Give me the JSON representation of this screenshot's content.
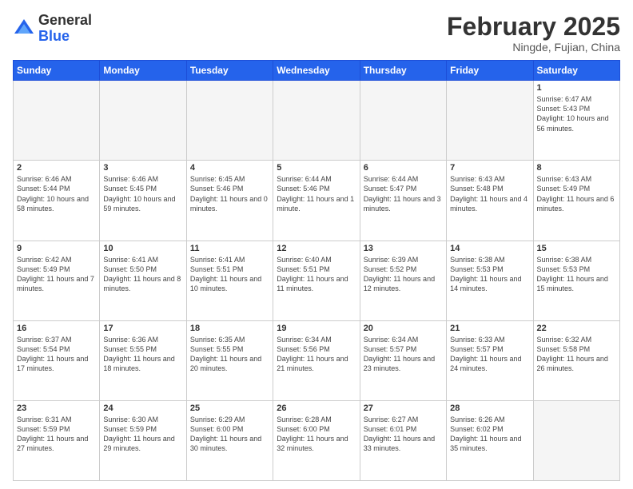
{
  "logo": {
    "general": "General",
    "blue": "Blue"
  },
  "title": {
    "month_year": "February 2025",
    "location": "Ningde, Fujian, China"
  },
  "weekdays": [
    "Sunday",
    "Monday",
    "Tuesday",
    "Wednesday",
    "Thursday",
    "Friday",
    "Saturday"
  ],
  "weeks": [
    [
      {
        "day": "",
        "empty": true
      },
      {
        "day": "",
        "empty": true
      },
      {
        "day": "",
        "empty": true
      },
      {
        "day": "",
        "empty": true
      },
      {
        "day": "",
        "empty": true
      },
      {
        "day": "",
        "empty": true
      },
      {
        "day": "1",
        "sunrise": "6:47 AM",
        "sunset": "5:43 PM",
        "daylight": "10 hours and 56 minutes."
      }
    ],
    [
      {
        "day": "2",
        "sunrise": "6:46 AM",
        "sunset": "5:44 PM",
        "daylight": "10 hours and 58 minutes."
      },
      {
        "day": "3",
        "sunrise": "6:46 AM",
        "sunset": "5:45 PM",
        "daylight": "10 hours and 59 minutes."
      },
      {
        "day": "4",
        "sunrise": "6:45 AM",
        "sunset": "5:46 PM",
        "daylight": "11 hours and 0 minutes."
      },
      {
        "day": "5",
        "sunrise": "6:44 AM",
        "sunset": "5:46 PM",
        "daylight": "11 hours and 1 minute."
      },
      {
        "day": "6",
        "sunrise": "6:44 AM",
        "sunset": "5:47 PM",
        "daylight": "11 hours and 3 minutes."
      },
      {
        "day": "7",
        "sunrise": "6:43 AM",
        "sunset": "5:48 PM",
        "daylight": "11 hours and 4 minutes."
      },
      {
        "day": "8",
        "sunrise": "6:43 AM",
        "sunset": "5:49 PM",
        "daylight": "11 hours and 6 minutes."
      }
    ],
    [
      {
        "day": "9",
        "sunrise": "6:42 AM",
        "sunset": "5:49 PM",
        "daylight": "11 hours and 7 minutes."
      },
      {
        "day": "10",
        "sunrise": "6:41 AM",
        "sunset": "5:50 PM",
        "daylight": "11 hours and 8 minutes."
      },
      {
        "day": "11",
        "sunrise": "6:41 AM",
        "sunset": "5:51 PM",
        "daylight": "11 hours and 10 minutes."
      },
      {
        "day": "12",
        "sunrise": "6:40 AM",
        "sunset": "5:51 PM",
        "daylight": "11 hours and 11 minutes."
      },
      {
        "day": "13",
        "sunrise": "6:39 AM",
        "sunset": "5:52 PM",
        "daylight": "11 hours and 12 minutes."
      },
      {
        "day": "14",
        "sunrise": "6:38 AM",
        "sunset": "5:53 PM",
        "daylight": "11 hours and 14 minutes."
      },
      {
        "day": "15",
        "sunrise": "6:38 AM",
        "sunset": "5:53 PM",
        "daylight": "11 hours and 15 minutes."
      }
    ],
    [
      {
        "day": "16",
        "sunrise": "6:37 AM",
        "sunset": "5:54 PM",
        "daylight": "11 hours and 17 minutes."
      },
      {
        "day": "17",
        "sunrise": "6:36 AM",
        "sunset": "5:55 PM",
        "daylight": "11 hours and 18 minutes."
      },
      {
        "day": "18",
        "sunrise": "6:35 AM",
        "sunset": "5:55 PM",
        "daylight": "11 hours and 20 minutes."
      },
      {
        "day": "19",
        "sunrise": "6:34 AM",
        "sunset": "5:56 PM",
        "daylight": "11 hours and 21 minutes."
      },
      {
        "day": "20",
        "sunrise": "6:34 AM",
        "sunset": "5:57 PM",
        "daylight": "11 hours and 23 minutes."
      },
      {
        "day": "21",
        "sunrise": "6:33 AM",
        "sunset": "5:57 PM",
        "daylight": "11 hours and 24 minutes."
      },
      {
        "day": "22",
        "sunrise": "6:32 AM",
        "sunset": "5:58 PM",
        "daylight": "11 hours and 26 minutes."
      }
    ],
    [
      {
        "day": "23",
        "sunrise": "6:31 AM",
        "sunset": "5:59 PM",
        "daylight": "11 hours and 27 minutes."
      },
      {
        "day": "24",
        "sunrise": "6:30 AM",
        "sunset": "5:59 PM",
        "daylight": "11 hours and 29 minutes."
      },
      {
        "day": "25",
        "sunrise": "6:29 AM",
        "sunset": "6:00 PM",
        "daylight": "11 hours and 30 minutes."
      },
      {
        "day": "26",
        "sunrise": "6:28 AM",
        "sunset": "6:00 PM",
        "daylight": "11 hours and 32 minutes."
      },
      {
        "day": "27",
        "sunrise": "6:27 AM",
        "sunset": "6:01 PM",
        "daylight": "11 hours and 33 minutes."
      },
      {
        "day": "28",
        "sunrise": "6:26 AM",
        "sunset": "6:02 PM",
        "daylight": "11 hours and 35 minutes."
      },
      {
        "day": "",
        "empty": true
      }
    ]
  ]
}
